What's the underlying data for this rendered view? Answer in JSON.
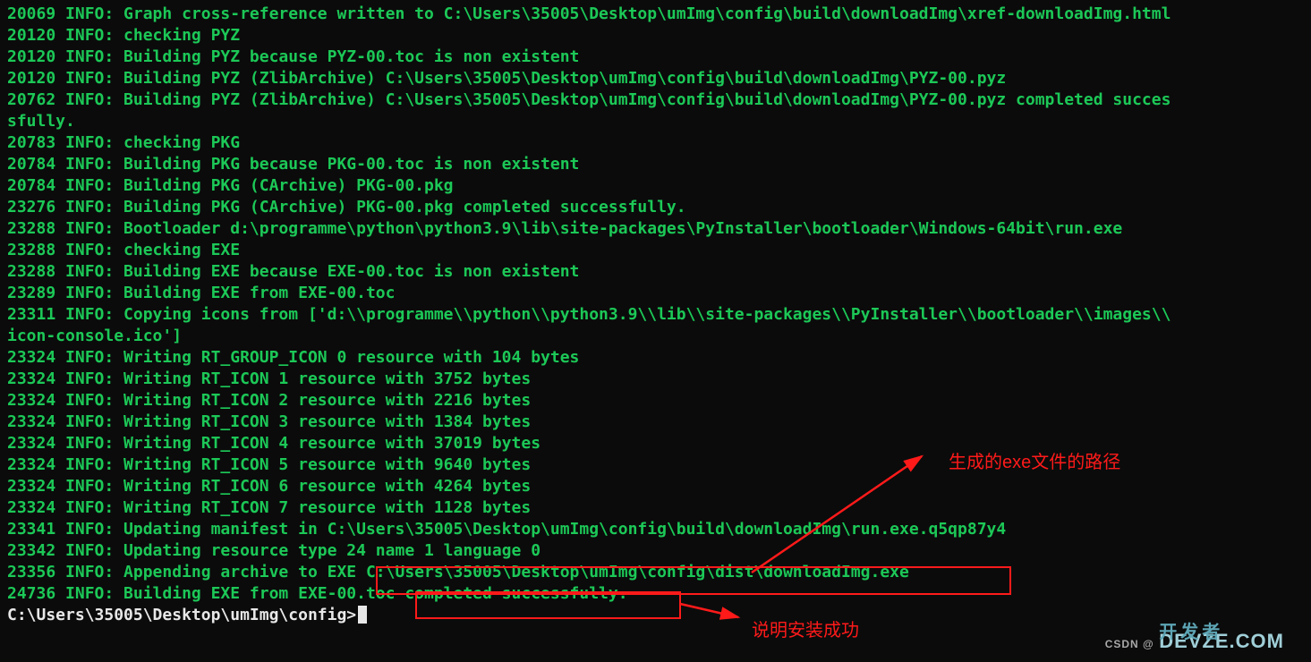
{
  "terminal": {
    "lines": [
      "20069 INFO: Graph cross-reference written to C:\\Users\\35005\\Desktop\\umImg\\config\\build\\downloadImg\\xref-downloadImg.html",
      "20120 INFO: checking PYZ",
      "20120 INFO: Building PYZ because PYZ-00.toc is non existent",
      "20120 INFO: Building PYZ (ZlibArchive) C:\\Users\\35005\\Desktop\\umImg\\config\\build\\downloadImg\\PYZ-00.pyz",
      "20762 INFO: Building PYZ (ZlibArchive) C:\\Users\\35005\\Desktop\\umImg\\config\\build\\downloadImg\\PYZ-00.pyz completed succes",
      "sfully.",
      "20783 INFO: checking PKG",
      "20784 INFO: Building PKG because PKG-00.toc is non existent",
      "20784 INFO: Building PKG (CArchive) PKG-00.pkg",
      "23276 INFO: Building PKG (CArchive) PKG-00.pkg completed successfully.",
      "23288 INFO: Bootloader d:\\programme\\python\\python3.9\\lib\\site-packages\\PyInstaller\\bootloader\\Windows-64bit\\run.exe",
      "23288 INFO: checking EXE",
      "23288 INFO: Building EXE because EXE-00.toc is non existent",
      "23289 INFO: Building EXE from EXE-00.toc",
      "23311 INFO: Copying icons from ['d:\\\\programme\\\\python\\\\python3.9\\\\lib\\\\site-packages\\\\PyInstaller\\\\bootloader\\\\images\\\\",
      "icon-console.ico']",
      "23324 INFO: Writing RT_GROUP_ICON 0 resource with 104 bytes",
      "23324 INFO: Writing RT_ICON 1 resource with 3752 bytes",
      "23324 INFO: Writing RT_ICON 2 resource with 2216 bytes",
      "23324 INFO: Writing RT_ICON 3 resource with 1384 bytes",
      "23324 INFO: Writing RT_ICON 4 resource with 37019 bytes",
      "23324 INFO: Writing RT_ICON 5 resource with 9640 bytes",
      "23324 INFO: Writing RT_ICON 6 resource with 4264 bytes",
      "23324 INFO: Writing RT_ICON 7 resource with 1128 bytes",
      "23341 INFO: Updating manifest in C:\\Users\\35005\\Desktop\\umImg\\config\\build\\downloadImg\\run.exe.q5qp87y4",
      "23342 INFO: Updating resource type 24 name 1 language 0",
      "23356 INFO: Appending archive to EXE C:\\Users\\35005\\Desktop\\umImg\\config\\dist\\downloadImg.exe",
      "24736 INFO: Building EXE from EXE-00.toc completed successfully."
    ],
    "prompt": "C:\\Users\\35005\\Desktop\\umImg\\config>"
  },
  "annotations": {
    "path_label": "生成的exe文件的路径",
    "success_label": "说明安装成功"
  },
  "watermark": {
    "small": "CSDN @",
    "big": "DEVZE.COM",
    "overlay": "开发者"
  }
}
